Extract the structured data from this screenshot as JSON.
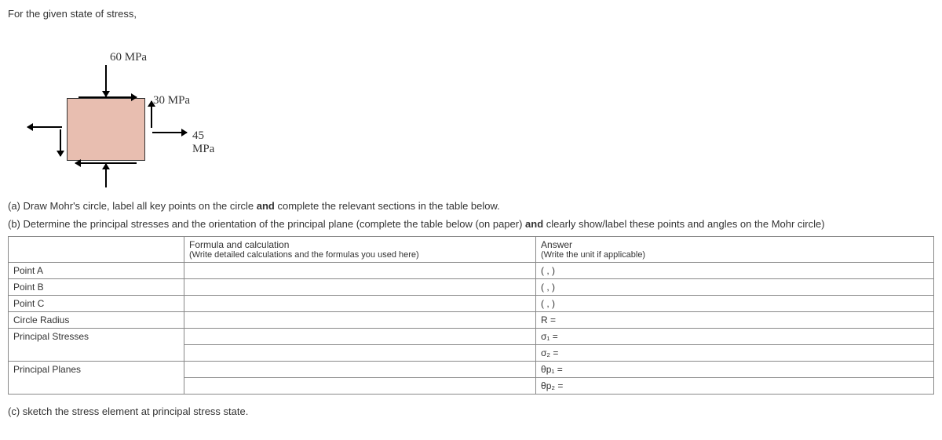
{
  "intro": "For the given state of stress,",
  "diagram": {
    "val60": "60 MPa",
    "val30": "30 MPa",
    "val45": "45 MPa"
  },
  "parts": {
    "a_pre": "(a) Draw Mohr's circle, label all key points on the circle ",
    "a_bold": "and",
    "a_post": " complete the relevant sections in the table below.",
    "b_pre": "(b) Determine the principal stresses and the orientation of the principal plane (complete the table below (on paper) ",
    "b_bold": "and",
    "b_post": " clearly show/label these points and angles on the Mohr circle)",
    "c": "(c) sketch the stress element at principal stress state."
  },
  "table": {
    "header": {
      "col1": "",
      "col2_line1": "Formula and calculation",
      "col2_line2": "(Write detailed calculations and the formulas you used here)",
      "col3_line1": "Answer",
      "col3_line2": "(Write the unit if applicable)"
    },
    "rows": {
      "pointA": {
        "label": "Point A",
        "answer": "(       ,       )"
      },
      "pointB": {
        "label": "Point B",
        "answer": "(       ,       )"
      },
      "pointC": {
        "label": "Point C",
        "answer": "(       ,       )"
      },
      "radius": {
        "label": "Circle Radius",
        "answer": "R ="
      },
      "principal_stresses": {
        "label": "Principal Stresses",
        "answer1": "σ₁ =",
        "answer2": "σ₂ ="
      },
      "principal_planes": {
        "label": "Principal Planes",
        "answer1": "θp₁ =",
        "answer2": "θp₂ ="
      }
    }
  }
}
